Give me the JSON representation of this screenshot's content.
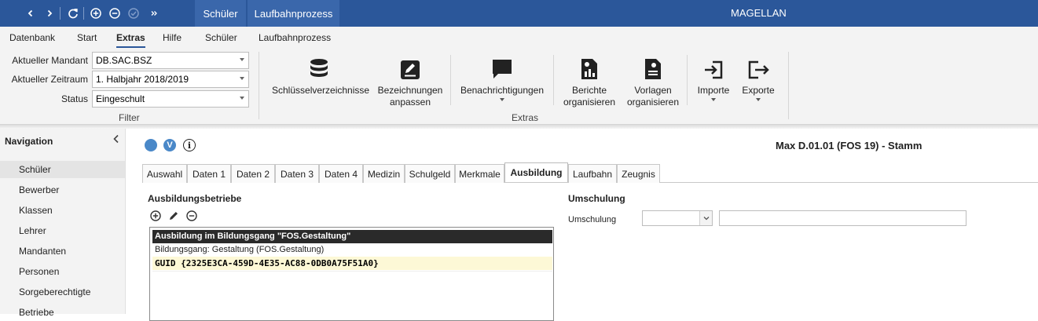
{
  "titlebar": {
    "app_title": "MAGELLAN",
    "context_tabs": [
      "Schüler",
      "Laufbahnprozess"
    ]
  },
  "menu": {
    "items": [
      "Datenbank",
      "Start",
      "Extras",
      "Hilfe",
      "Schüler",
      "Laufbahnprozess"
    ],
    "active": "Extras"
  },
  "filter": {
    "group_label": "Filter",
    "mandant_label": "Aktueller Mandant",
    "mandant_value": "DB.SAC.BSZ",
    "zeitraum_label": "Aktueller Zeitraum",
    "zeitraum_value": "1. Halbjahr 2018/2019",
    "status_label": "Status",
    "status_value": "Eingeschult"
  },
  "extras": {
    "group_label": "Extras",
    "schluessel": "Schlüsselverzeichnisse",
    "bez_line1": "Bezeichnungen",
    "bez_line2": "anpassen",
    "benachrichtigungen": "Benachrichtigungen",
    "berichte_line1": "Berichte",
    "berichte_line2": "organisieren",
    "vorlagen_line1": "Vorlagen",
    "vorlagen_line2": "organisieren",
    "importe": "Importe",
    "exporte": "Exporte"
  },
  "navigation": {
    "title": "Navigation",
    "items": [
      "Schüler",
      "Bewerber",
      "Klassen",
      "Lehrer",
      "Mandanten",
      "Personen",
      "Sorgeberechtigte",
      "Betriebe"
    ],
    "selected": "Schüler"
  },
  "record": {
    "v_badge": "V",
    "info_badge": "i",
    "title": "Max D.01.01 (FOS 19) - Stamm"
  },
  "tabs": [
    "Auswahl",
    "Daten 1",
    "Daten 2",
    "Daten 3",
    "Daten 4",
    "Medizin",
    "Schulgeld",
    "Merkmale",
    "Ausbildung",
    "Laufbahn",
    "Zeugnis"
  ],
  "active_tab": "Ausbildung",
  "ausbildung": {
    "section_title": "Ausbildungsbetriebe",
    "rows": [
      "Ausbildung im Bildungsgang \"FOS.Gestaltung\"",
      "Bildungsgang: Gestaltung (FOS.Gestaltung)",
      "GUID {2325E3CA-459D-4E35-AC88-0DB0A75F51A0}"
    ]
  },
  "umschulung": {
    "section_title": "Umschulung",
    "label": "Umschulung",
    "select_value": "",
    "text_value": ""
  },
  "colors": {
    "titlebar": "#2b579a",
    "accent_blue": "#4a88c8",
    "guid_highlight": "#fdf8d6",
    "header_row": "#2a2a2a"
  }
}
